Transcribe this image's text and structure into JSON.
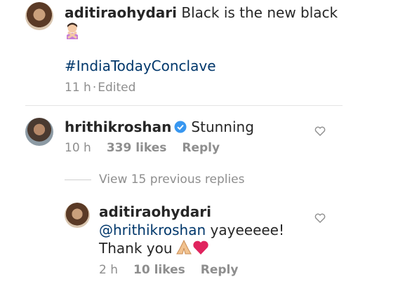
{
  "post_caption": {
    "username": "aditiraohydari",
    "text": "Black is the new black",
    "hashtag": "#IndiaTodayConclave",
    "time": "11 h",
    "separator": "·",
    "edited": "Edited"
  },
  "comment_hrithik": {
    "username": "hrithikroshan",
    "text": "Stunning",
    "time": "10 h",
    "likes": "339 likes",
    "reply_label": "Reply"
  },
  "view_replies": "View 15 previous replies",
  "reply_aditi": {
    "username": "aditiraohydari",
    "mention": "@hrithikroshan",
    "text": "yayeeeee!",
    "text2": "Thank you",
    "time": "2 h",
    "likes": "10 likes",
    "reply_label": "Reply"
  },
  "colors": {
    "text": "#262626",
    "secondary": "#8e8e8e",
    "link": "#00376b",
    "verified": "#3897f0",
    "heart_emoji": "#e0245e"
  },
  "icons": [
    "heart-icon",
    "verified-badge-icon",
    "folded-hands-emoji",
    "red-heart-emoji",
    "woman-gesturing-no-emoji"
  ]
}
